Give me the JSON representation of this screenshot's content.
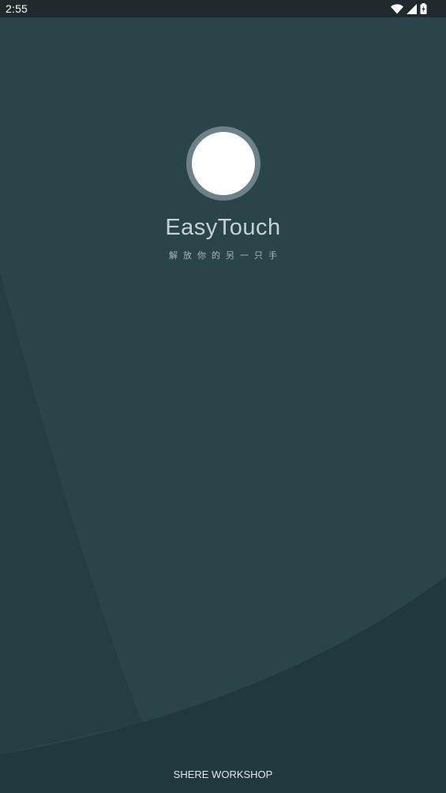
{
  "status_bar": {
    "time": "2:55",
    "icons": [
      "wifi-icon",
      "cellular-signal-icon",
      "battery-charging-icon"
    ]
  },
  "splash": {
    "logo": "floating-touch-ball-logo",
    "title": "EasyTouch",
    "subtitle": "解放你的另一只手"
  },
  "footer": {
    "credit": "SHERE WORKSHOP"
  },
  "colors": {
    "background_light": "#2a454a",
    "background_dark": "#213a3f",
    "status_bar": "#20292c",
    "logo_ring": "#6c8288",
    "logo_core": "#ffffff",
    "title_text": "#c7d1d3"
  }
}
